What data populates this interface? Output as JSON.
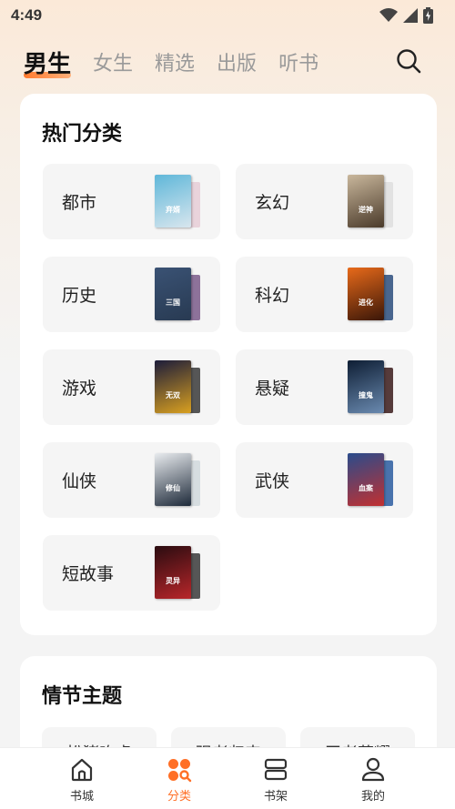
{
  "status_bar": {
    "time": "4:49"
  },
  "top_tabs": [
    {
      "label": "男生",
      "active": true
    },
    {
      "label": "女生",
      "active": false
    },
    {
      "label": "精选",
      "active": false
    },
    {
      "label": "出版",
      "active": false
    },
    {
      "label": "听书",
      "active": false
    }
  ],
  "hot_categories": {
    "title": "热门分类",
    "items": [
      {
        "label": "都市",
        "cover_text": "弃婿",
        "colors": [
          "#5fb7d9",
          "#d8e6ee"
        ]
      },
      {
        "label": "玄幻",
        "cover_text": "逆神",
        "colors": [
          "#4a3a2a",
          "#c9b79c"
        ]
      },
      {
        "label": "历史",
        "cover_text": "三国",
        "colors": [
          "#283a52",
          "#7a5a8a"
        ]
      },
      {
        "label": "科幻",
        "cover_text": "进化",
        "colors": [
          "#3a1608",
          "#e86a1a"
        ]
      },
      {
        "label": "游戏",
        "cover_text": "无双",
        "colors": [
          "#1c1c3a",
          "#d9a020"
        ]
      },
      {
        "label": "悬疑",
        "cover_text": "撞鬼",
        "colors": [
          "#0e1e34",
          "#6a8ab0"
        ]
      },
      {
        "label": "仙侠",
        "cover_text": "修仙",
        "colors": [
          "#e9ecef",
          "#1e2a3a"
        ]
      },
      {
        "label": "武侠",
        "cover_text": "血案",
        "colors": [
          "#2a4c8c",
          "#c23030"
        ]
      },
      {
        "label": "短故事",
        "cover_text": "灵异",
        "colors": [
          "#2a0c10",
          "#b8262a"
        ]
      }
    ]
  },
  "plot_themes": {
    "title": "情节主题",
    "chips": [
      "扮猪吃虎",
      "强者归来",
      "王者荣耀"
    ]
  },
  "bottom_nav": [
    {
      "label": "书城",
      "icon": "home-icon",
      "active": false
    },
    {
      "label": "分类",
      "icon": "category-icon",
      "active": true
    },
    {
      "label": "书架",
      "icon": "bookshelf-icon",
      "active": false
    },
    {
      "label": "我的",
      "icon": "profile-icon",
      "active": false
    }
  ],
  "colors": {
    "accent": "#ff6f26",
    "page_bg": "#f4f4f4",
    "card_bg": "#ffffff",
    "tile_bg": "#f5f5f5"
  }
}
